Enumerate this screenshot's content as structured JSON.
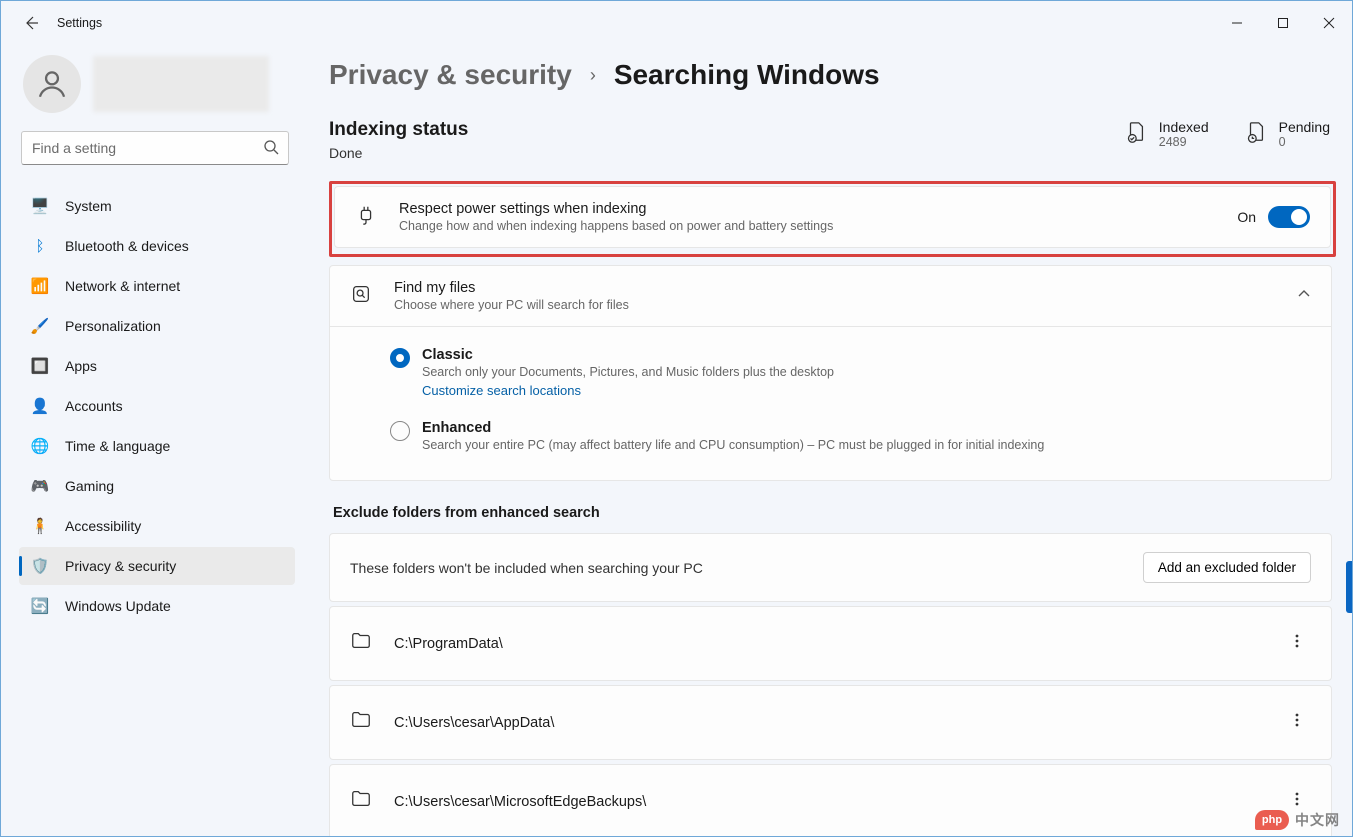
{
  "title": "Settings",
  "search": {
    "placeholder": "Find a setting"
  },
  "nav": [
    {
      "icon": "🖥️",
      "label": "System"
    },
    {
      "icon": "ᛒ",
      "label": "Bluetooth & devices",
      "iconColor": "#0078d4"
    },
    {
      "icon": "📶",
      "label": "Network & internet",
      "iconColor": "#0aa3d6"
    },
    {
      "icon": "🖌️",
      "label": "Personalization"
    },
    {
      "icon": "🔲",
      "label": "Apps",
      "iconColor": "#3b78e7"
    },
    {
      "icon": "👤",
      "label": "Accounts",
      "iconColor": "#1fa05a"
    },
    {
      "icon": "🌐",
      "label": "Time & language"
    },
    {
      "icon": "🎮",
      "label": "Gaming"
    },
    {
      "icon": "🧍",
      "label": "Accessibility",
      "iconColor": "#0067c0"
    },
    {
      "icon": "🛡️",
      "label": "Privacy & security",
      "iconColor": "#888"
    },
    {
      "icon": "🔄",
      "label": "Windows Update",
      "iconColor": "#d97b0d"
    }
  ],
  "nav_active_index": 9,
  "breadcrumb": {
    "parent": "Privacy & security",
    "sep": "›",
    "current": "Searching Windows"
  },
  "status": {
    "heading": "Indexing status",
    "value": "Done",
    "indexed_label": "Indexed",
    "indexed_value": "2489",
    "pending_label": "Pending",
    "pending_value": "0"
  },
  "power_setting": {
    "title": "Respect power settings when indexing",
    "desc": "Change how and when indexing happens based on power and battery settings",
    "state_label": "On"
  },
  "find_files": {
    "title": "Find my files",
    "desc": "Choose where your PC will search for files",
    "options": [
      {
        "title": "Classic",
        "desc": "Search only your Documents, Pictures, and Music folders plus the desktop",
        "link": "Customize search locations",
        "checked": true
      },
      {
        "title": "Enhanced",
        "desc": "Search your entire PC (may affect battery life and CPU consumption) – PC must be plugged in for initial indexing",
        "checked": false
      }
    ]
  },
  "exclude": {
    "heading": "Exclude folders from enhanced search",
    "intro": "These folders won't be included when searching your PC",
    "add_button": "Add an excluded folder",
    "folders": [
      "C:\\ProgramData\\",
      "C:\\Users\\cesar\\AppData\\",
      "C:\\Users\\cesar\\MicrosoftEdgeBackups\\"
    ]
  },
  "watermark": "中文网"
}
